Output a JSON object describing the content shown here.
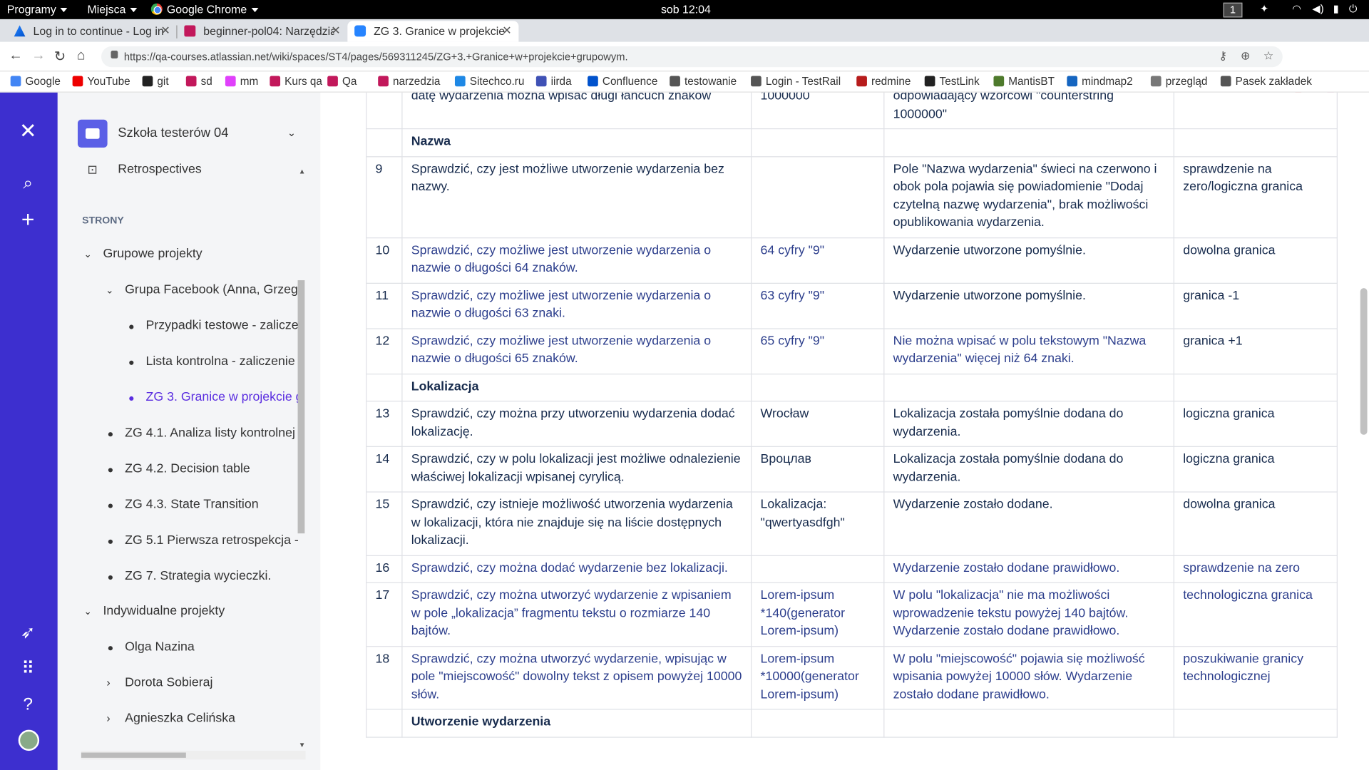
{
  "os": {
    "menu1": "Programy",
    "menu2": "Miejsca",
    "menu3": "Google Chrome",
    "clock": "sob 12:04",
    "workspace": "1"
  },
  "tabs": [
    {
      "title": "Log in to continue - Log in"
    },
    {
      "title": "beginner-pol04: Narzędzia"
    },
    {
      "title": "ZG 3. Granice w projekcie"
    }
  ],
  "address": {
    "url": "https://qa-courses.atlassian.net/wiki/spaces/ST4/pages/569311245/ZG+3.+Granice+w+projekcie+grupowym."
  },
  "bookmarks": [
    {
      "label": "Google",
      "color": "#4285f4"
    },
    {
      "label": "YouTube",
      "color": "#e00"
    },
    {
      "label": "git",
      "color": "#222"
    },
    {
      "label": "sd",
      "color": "#c2185b"
    },
    {
      "label": "mm",
      "color": "#e040fb"
    },
    {
      "label": "Kurs qa",
      "color": "#c2185b"
    },
    {
      "label": "Qa",
      "color": "#c2185b"
    },
    {
      "label": "narzedzia",
      "color": "#c2185b"
    },
    {
      "label": "Sitechco.ru",
      "color": "#1e88e5"
    },
    {
      "label": "iirda",
      "color": "#3f51b5"
    },
    {
      "label": "Confluence",
      "color": "#0052cc"
    },
    {
      "label": "testowanie",
      "color": "#555"
    },
    {
      "label": "Login - TestRail",
      "color": "#555"
    },
    {
      "label": "redmine",
      "color": "#b71c1c"
    },
    {
      "label": "TestLink",
      "color": "#222"
    },
    {
      "label": "MantisBT",
      "color": "#4e7a2c"
    },
    {
      "label": "mindmap2",
      "color": "#1565c0"
    },
    {
      "label": "przegląd",
      "color": "#777"
    },
    {
      "label": "Pasek zakładek",
      "color": "#555"
    }
  ],
  "sidebar": {
    "space_name": "Szkoła testerów 04",
    "retro": "Retrospectives",
    "section_label": "STRONY",
    "items": [
      {
        "label": "Grupowe projekty"
      },
      {
        "label": "Grupa Facebook (Anna, Grzeg"
      },
      {
        "label": "Przypadki testowe - zalicze"
      },
      {
        "label": "Lista kontrolna - zaliczenie"
      },
      {
        "label": "ZG 3. Granice w projekcie g"
      },
      {
        "label": "ZG 4.1. Analiza listy kontrolnej"
      },
      {
        "label": "ZG 4.2. Decision table"
      },
      {
        "label": "ZG 4.3. State Transition"
      },
      {
        "label": "ZG 5.1 Pierwsza retrospekcja -"
      },
      {
        "label": "ZG 7. Strategia wycieczki."
      },
      {
        "label": "Indywidualne projekty"
      },
      {
        "label": "Olga Nazina"
      },
      {
        "label": "Dorota Sobieraj"
      },
      {
        "label": "Agnieszka Celińska"
      }
    ]
  },
  "table": {
    "rows": [
      {
        "no": "",
        "desc": "datę wydarzenia można wpisać długi łańcuch znaków",
        "data": "1000000",
        "expected": "odpowiadający wzorcowi \"counterstring 1000000\"",
        "type": ""
      },
      {
        "no": "",
        "desc": "Nazwa",
        "data": "",
        "expected": "",
        "type": ""
      },
      {
        "no": "9",
        "desc": "Sprawdzić, czy jest możliwe utworzenie wydarzenia bez nazwy.",
        "data": "",
        "expected": "Pole \"Nazwa wydarzenia\" świeci na czerwono i obok pola pojawia się powiadomienie \"Dodaj czytelną nazwę wydarzenia\", brak możliwości opublikowania wydarzenia.",
        "type": "sprawdzenie na zero/logiczna granica"
      },
      {
        "no": "10",
        "desc": "Sprawdzić, czy możliwe jest utworzenie wydarzenia o nazwie o długości 64 znaków.",
        "data": "64 cyfry \"9\"",
        "expected": "Wydarzenie utworzone pomyślnie.",
        "type": "dowolna granica"
      },
      {
        "no": "11",
        "desc": "Sprawdzić, czy możliwe jest utworzenie wydarzenia o nazwie o długości 63 znaki.",
        "data": "63 cyfry \"9\"",
        "expected": "Wydarzenie utworzone pomyślnie.",
        "type": "granica -1"
      },
      {
        "no": "12",
        "desc": "Sprawdzić, czy możliwe jest utworzenie wydarzenia o nazwie o długości 65 znaków.",
        "data": "65 cyfry \"9\"",
        "expected": "Nie można wpisać w polu tekstowym \"Nazwa wydarzenia\" więcej niż 64 znaki.",
        "type": "granica +1"
      },
      {
        "no": "",
        "desc": "Lokalizacja",
        "data": "",
        "expected": "",
        "type": ""
      },
      {
        "no": "13",
        "desc": "Sprawdzić, czy można przy utworzeniu wydarzenia dodać lokalizację.",
        "data": "Wrocław",
        "expected": "Lokalizacja została pomyślnie dodana do wydarzenia.",
        "type": "logiczna granica"
      },
      {
        "no": "14",
        "desc": "Sprawdzić, czy w polu lokalizacji jest możliwe odnalezienie właściwej lokalizacji wpisanej cyrylicą.",
        "data": "Вроцлав",
        "expected": "Lokalizacja została pomyślnie dodana do wydarzenia.",
        "type": "logiczna granica"
      },
      {
        "no": "15",
        "desc": "Sprawdzić, czy istnieje możliwość utworzenia wydarzenia w lokalizacji, która nie znajduje się na liście dostępnych lokalizacji.",
        "data": "Lokalizacja: \"qwertyasdfgh\"",
        "expected": "Wydarzenie zostało dodane.",
        "type": "dowolna granica"
      },
      {
        "no": "16",
        "desc": "Sprawdzić, czy można dodać wydarzenie bez lokalizacji.",
        "data": "",
        "expected": "Wydarzenie zostało dodane prawidłowo.",
        "type": "sprawdzenie na zero"
      },
      {
        "no": "17",
        "desc": "Sprawdzić, czy można utworzyć wydarzenie z wpisaniem w pole „lokalizacja” fragmentu tekstu o rozmiarze 140 bajtów.",
        "data": "Lorem-ipsum *140(generator Lorem-ipsum)",
        "expected": "W polu \"lokalizacja\" nie ma możliwości wprowadzenie tekstu powyżej 140 bajtów. Wydarzenie zostało dodane prawidłowo.",
        "type": "technologiczna granica"
      },
      {
        "no": "18",
        "desc": "Sprawdzić, czy można utworzyć wydarzenie, wpisując w pole \"miejscowość\" dowolny tekst z opisem powyżej 10000 słów.",
        "data": "Lorem-ipsum *10000(generator Lorem-ipsum)",
        "expected": "W polu \"miejscowość\" pojawia się możliwość wpisania powyżej 10000 słów. Wydarzenie zostało dodane prawidłowo.",
        "type": "poszukiwanie granicy technologicznej"
      },
      {
        "no": "",
        "desc": "Utworzenie wydarzenia",
        "data": "",
        "expected": "",
        "type": ""
      }
    ]
  }
}
